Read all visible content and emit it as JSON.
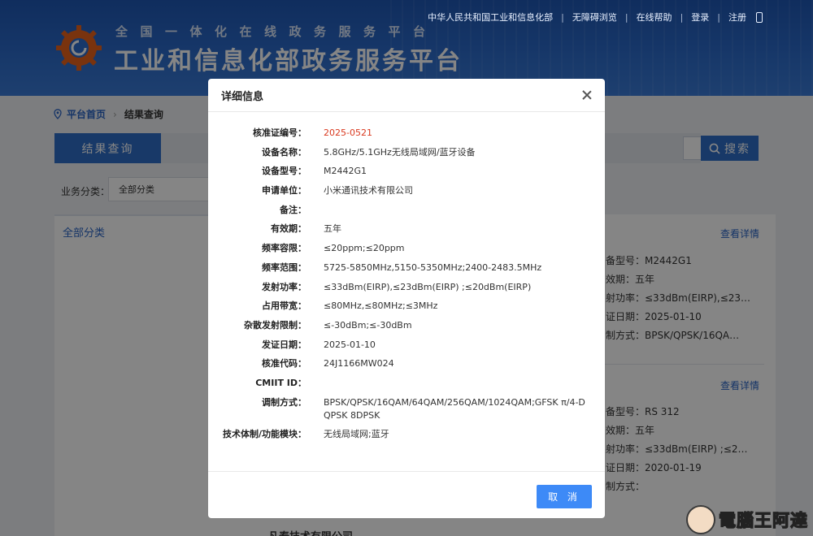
{
  "header": {
    "subtitle": "全国一体化在线政务服务平台",
    "title": "工业和信息化部政务服务平台",
    "top_links": [
      "中华人民共和国工业和信息化部",
      "无障碍浏览",
      "在线帮助",
      "登录",
      "注册"
    ]
  },
  "breadcrumb": {
    "home": "平台首页",
    "current": "结果查询"
  },
  "tabs": {
    "results": "结果查询"
  },
  "search": {
    "button": "搜索"
  },
  "filter": {
    "label": "业务分类：",
    "selected": "全部分类"
  },
  "left_panel": {
    "category": "全部分类"
  },
  "background_results": [
    {
      "view_detail": "查看详情",
      "lines": [
        "备型号：M2442G1",
        "效期：五年",
        "射功率：≤33dBm(EIRP),≤23…",
        "证日期：2025-01-10",
        "制方式：BPSK/QPSK/16QA…"
      ]
    },
    {
      "view_detail": "查看详情",
      "lines": [
        "备型号：RS 312",
        "效期：五年",
        "射功率：≤33dBm(EIRP) ;≤2…",
        "证日期：2020-01-19",
        "制方式："
      ]
    }
  ],
  "bottom_company": "凡泰技术有限公司",
  "dialog": {
    "title": "详细信息",
    "rows": [
      {
        "label": "核准证编号：",
        "value": "2025-0521",
        "highlight": true
      },
      {
        "label": "设备名称：",
        "value": "5.8GHz/5.1GHz无线局域网/蓝牙设备"
      },
      {
        "label": "设备型号：",
        "value": "M2442G1"
      },
      {
        "label": "申请单位：",
        "value": "小米通讯技术有限公司"
      },
      {
        "label": "备注：",
        "value": ""
      },
      {
        "label": "有效期：",
        "value": "五年"
      },
      {
        "label": "频率容限：",
        "value": "≤20ppm;≤20ppm"
      },
      {
        "label": "频率范围：",
        "value": "5725-5850MHz,5150-5350MHz;2400-2483.5MHz"
      },
      {
        "label": "发射功率：",
        "value": "≤33dBm(EIRP),≤23dBm(EIRP) ;≤20dBm(EIRP)"
      },
      {
        "label": "占用带宽：",
        "value": "≤80MHz,≤80MHz;≤3MHz"
      },
      {
        "label": "杂散发射限制：",
        "value": "≤-30dBm;≤-30dBm"
      },
      {
        "label": "发证日期：",
        "value": "2025-01-10"
      },
      {
        "label": "核准代码：",
        "value": "24J1166MW024"
      },
      {
        "label": "CMIIT ID：",
        "value": ""
      },
      {
        "label": "调制方式：",
        "value": "BPSK/QPSK/16QAM/64QAM/256QAM/1024QAM;GFSK π/4-DQPSK 8DPSK"
      },
      {
        "label": "技术体制/功能模块：",
        "value": "无线局域网;蓝牙"
      }
    ],
    "cancel_label": "取 消"
  },
  "watermark": "電腦王阿達",
  "colors": {
    "accent": "#2f6ec8",
    "header": "#2d6ccb",
    "highlight_red": "#d9381e",
    "cancel_button": "#3d8af7"
  }
}
